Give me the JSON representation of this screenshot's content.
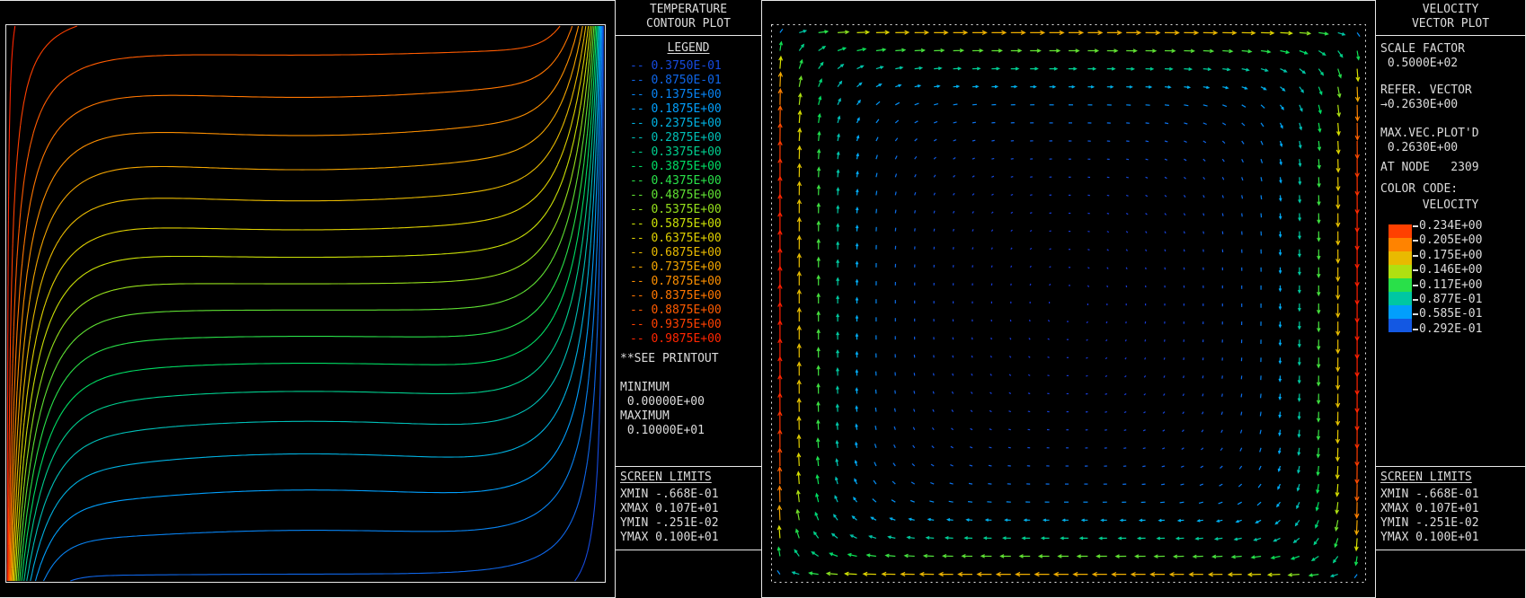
{
  "colors": {
    "background": "#000000",
    "text": "#dcdcdc",
    "border": "#e8e8e8",
    "colormap": [
      "#1b35d6",
      "#00a6ff",
      "#00e05a",
      "#d8e000",
      "#ff8a00",
      "#ff1e00"
    ]
  },
  "icons": {
    "ref_vector_arrow": "→"
  },
  "contour_panel": {
    "title_line1": "TEMPERATURE",
    "title_line2": "CONTOUR PLOT",
    "legend_title": "LEGEND",
    "levels": [
      {
        "label": "0.3750E-01",
        "value": 0.0375
      },
      {
        "label": "0.8750E-01",
        "value": 0.0875
      },
      {
        "label": "0.1375E+00",
        "value": 0.1375
      },
      {
        "label": "0.1875E+00",
        "value": 0.1875
      },
      {
        "label": "0.2375E+00",
        "value": 0.2375
      },
      {
        "label": "0.2875E+00",
        "value": 0.2875
      },
      {
        "label": "0.3375E+00",
        "value": 0.3375
      },
      {
        "label": "0.3875E+00",
        "value": 0.3875
      },
      {
        "label": "0.4375E+00",
        "value": 0.4375
      },
      {
        "label": "0.4875E+00",
        "value": 0.4875
      },
      {
        "label": "0.5375E+00",
        "value": 0.5375
      },
      {
        "label": "0.5875E+00",
        "value": 0.5875
      },
      {
        "label": "0.6375E+00",
        "value": 0.6375
      },
      {
        "label": "0.6875E+00",
        "value": 0.6875
      },
      {
        "label": "0.7375E+00",
        "value": 0.7375
      },
      {
        "label": "0.7875E+00",
        "value": 0.7875
      },
      {
        "label": "0.8375E+00",
        "value": 0.8375
      },
      {
        "label": "0.8875E+00",
        "value": 0.8875
      },
      {
        "label": "0.9375E+00",
        "value": 0.9375
      },
      {
        "label": "0.9875E+00",
        "value": 0.9875
      }
    ],
    "see_printout": "**SEE PRINTOUT",
    "minimum_label": "MINIMUM",
    "minimum_value": " 0.00000E+00",
    "maximum_label": "MAXIMUM",
    "maximum_value": " 0.10000E+01",
    "screen_limits_title": "SCREEN LIMITS",
    "screen_limits": [
      "XMIN -.668E-01",
      "XMAX 0.107E+01",
      "YMIN -.251E-02",
      "YMAX 0.100E+01"
    ]
  },
  "vector_panel": {
    "title_line1": "VELOCITY",
    "title_line2": "VECTOR PLOT",
    "scale_factor_label": "SCALE FACTOR",
    "scale_factor_value": " 0.5000E+02",
    "refer_vector_label": "REFER. VECTOR",
    "refer_vector_value": "0.2630E+00",
    "max_vec_label": "MAX.VEC.PLOT'D",
    "max_vec_value": " 0.2630E+00",
    "at_node": "AT NODE   2309",
    "color_code_label": "COLOR CODE:",
    "color_code_value": "VELOCITY",
    "colorbar_labels": [
      "0.234E+00",
      "0.205E+00",
      "0.175E+00",
      "0.146E+00",
      "0.117E+00",
      "0.877E-01",
      "0.585E-01",
      "0.292E-01"
    ],
    "screen_limits_title": "SCREEN LIMITS",
    "screen_limits": [
      "XMIN -.668E-01",
      "XMAX 0.107E+01",
      "YMIN -.251E-02",
      "YMAX 0.100E+01"
    ]
  },
  "chart_data": [
    {
      "type": "contour",
      "title": "TEMPERATURE CONTOUR PLOT",
      "variable": "temperature",
      "contour_levels": [
        0.0375,
        0.0875,
        0.1375,
        0.1875,
        0.2375,
        0.2875,
        0.3375,
        0.3875,
        0.4375,
        0.4875,
        0.5375,
        0.5875,
        0.6375,
        0.6875,
        0.7375,
        0.7875,
        0.8375,
        0.8875,
        0.9375,
        0.9875
      ],
      "minimum": 0.0,
      "maximum": 1.0,
      "xlim": [
        -0.0668,
        1.07
      ],
      "ylim": [
        -0.00251,
        1.0
      ],
      "colormap": "rainbow, blue = low temperature, red = high temperature",
      "pattern": "isotherms of buoyant flow in a square cavity: hot wall on the left (red contours clustered), cold wall on the right (blue contours clustered), horizontally stratified core with gently undulating mid-level (green/yellow) isotherms"
    },
    {
      "type": "vector",
      "title": "VELOCITY VECTOR PLOT",
      "variable": "velocity",
      "scale_factor": 50.0,
      "reference_vector": 0.263,
      "max_vector_plotted": 0.263,
      "max_vector_node": 2309,
      "colorbar_values": [
        0.234,
        0.205,
        0.175,
        0.146,
        0.117,
        0.0877,
        0.0585,
        0.0292
      ],
      "xlim": [
        -0.0668,
        1.07
      ],
      "ylim": [
        -0.00251,
        1.0
      ],
      "pattern": "single-cell circulation: fast (red/orange) jets up the left wall and down the right wall, moderate (green/yellow) flow along top and bottom walls, nearly stagnant dark-blue core"
    }
  ]
}
